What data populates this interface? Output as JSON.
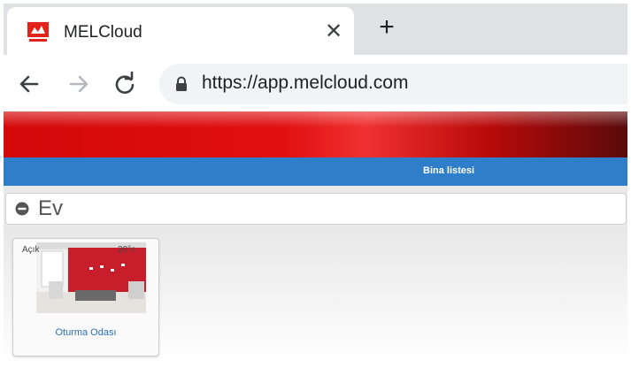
{
  "browser": {
    "tab": {
      "title": "MELCloud",
      "close_glyph": "✕"
    },
    "new_tab_glyph": "+",
    "address": {
      "url": "https://app.melcloud.com"
    }
  },
  "app": {
    "menu": {
      "building_list_label": "Bina listesi"
    },
    "group": {
      "title": "Ev"
    },
    "room_card": {
      "state": "Açık",
      "temperature": "20°c",
      "name": "Oturma Odası"
    }
  },
  "colors": {
    "brand_red": "#e01010",
    "menu_blue": "#2f7ec9",
    "link_blue": "#2a6fb5"
  },
  "icons": [
    "melcloud-favicon-icon",
    "close-icon",
    "plus-icon",
    "back-arrow-icon",
    "forward-arrow-icon",
    "reload-icon",
    "lock-icon",
    "collapse-icon"
  ]
}
